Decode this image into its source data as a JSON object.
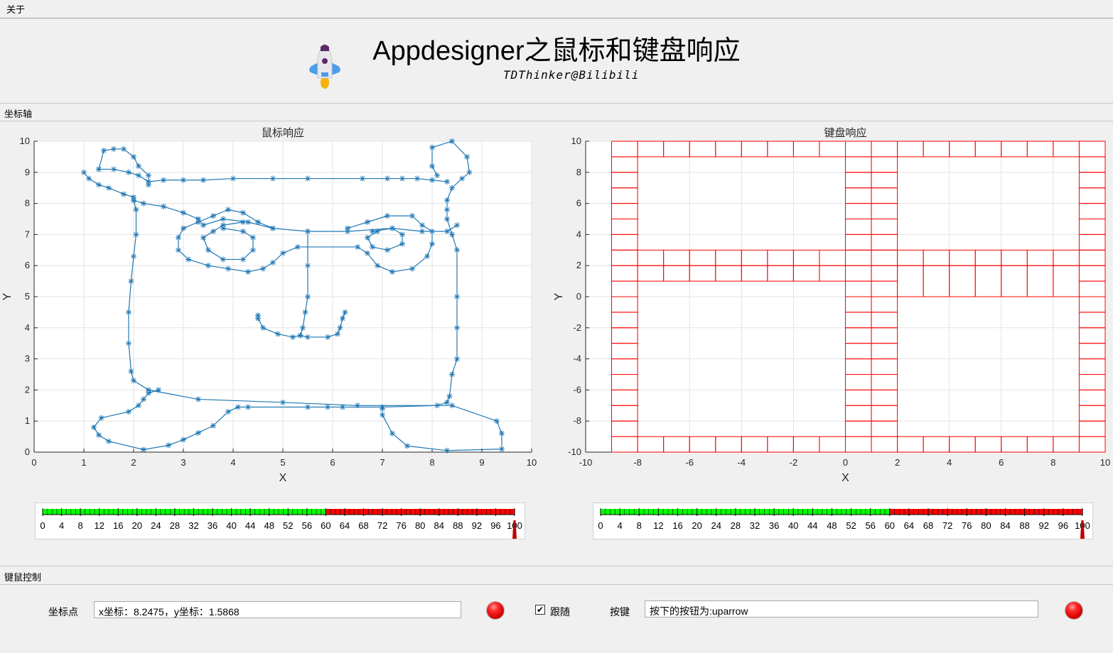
{
  "menu": {
    "about": "关于"
  },
  "header": {
    "title": "Appdesigner之鼠标和键盘响应",
    "subtitle": "TDThinker@Bilibili",
    "logo_icon": "rocket-icon"
  },
  "axes_panel": {
    "title": "坐标轴"
  },
  "control_panel": {
    "title": "键鼠控制"
  },
  "mouse_axes": {
    "title": "鼠标响应",
    "xlabel": "X",
    "ylabel": "Y",
    "xlim": [
      0,
      10
    ],
    "ylim": [
      0,
      10
    ],
    "xticks": [
      "0",
      "1",
      "2",
      "3",
      "4",
      "5",
      "6",
      "7",
      "8",
      "9",
      "10"
    ],
    "yticks": [
      "0",
      "1",
      "2",
      "3",
      "4",
      "5",
      "6",
      "7",
      "8",
      "9",
      "10"
    ],
    "line_color": "#1f77b4"
  },
  "keyboard_axes": {
    "title": "键盘响应",
    "xlabel": "X",
    "ylabel": "Y",
    "xlim": [
      -10,
      10
    ],
    "ylim": [
      -10,
      10
    ],
    "xticks": [
      "-10",
      "-8",
      "-6",
      "-4",
      "-2",
      "0",
      "2",
      "4",
      "6",
      "8",
      "10"
    ],
    "yticks": [
      "-10",
      "-8",
      "-6",
      "-4",
      "-2",
      "0",
      "2",
      "4",
      "6",
      "8",
      "10"
    ],
    "line_color": "#ff0000"
  },
  "gauges": {
    "ticks": [
      "0",
      "4",
      "8",
      "12",
      "16",
      "20",
      "24",
      "28",
      "32",
      "36",
      "40",
      "44",
      "48",
      "52",
      "56",
      "60",
      "64",
      "68",
      "72",
      "76",
      "80",
      "84",
      "88",
      "92",
      "96",
      "100"
    ],
    "green_to": 60,
    "green_color": "#00ff00",
    "red_color": "#ff0000",
    "left_value": 100,
    "right_value": 100
  },
  "controls": {
    "coord_label": "坐标点",
    "coord_value": "x坐标：8.2475，y坐标：1.5868",
    "follow_label": "跟随",
    "follow_checked": true,
    "key_label": "按键",
    "key_value": "按下的按钮为:uparrow",
    "lamp_color": "#ff0000"
  },
  "chart_data": [
    {
      "type": "line",
      "title": "鼠标响应",
      "xlabel": "X",
      "ylabel": "Y",
      "xlim": [
        0,
        10
      ],
      "ylim": [
        0,
        10
      ],
      "series": [
        {
          "points": [
            [
              1.0,
              9.0
            ],
            [
              1.1,
              8.8
            ],
            [
              1.3,
              8.6
            ],
            [
              1.5,
              8.5
            ],
            [
              1.8,
              8.3
            ],
            [
              2.0,
              8.2
            ],
            [
              2.0,
              8.1
            ],
            [
              2.2,
              8.0
            ],
            [
              2.6,
              7.9
            ],
            [
              3.0,
              7.7
            ],
            [
              3.3,
              7.5
            ],
            [
              3.4,
              7.3
            ],
            [
              3.8,
              7.5
            ],
            [
              4.3,
              7.4
            ],
            [
              4.8,
              7.2
            ],
            [
              5.5,
              7.1
            ],
            [
              6.3,
              7.1
            ],
            [
              7.2,
              7.2
            ],
            [
              7.8,
              7.1
            ],
            [
              8.3,
              7.1
            ],
            [
              8.5,
              7.3
            ]
          ]
        },
        {
          "points": [
            [
              1.3,
              9.1
            ],
            [
              1.6,
              9.1
            ],
            [
              1.9,
              9.0
            ],
            [
              2.1,
              8.9
            ],
            [
              2.3,
              8.7
            ],
            [
              2.6,
              8.75
            ],
            [
              3.0,
              8.75
            ],
            [
              3.4,
              8.75
            ],
            [
              4.0,
              8.8
            ],
            [
              4.8,
              8.8
            ],
            [
              5.5,
              8.8
            ],
            [
              6.6,
              8.8
            ],
            [
              7.1,
              8.8
            ],
            [
              7.4,
              8.8
            ],
            [
              7.7,
              8.8
            ],
            [
              8.0,
              8.75
            ],
            [
              8.3,
              8.7
            ]
          ]
        },
        {
          "points": [
            [
              1.3,
              9.1
            ],
            [
              1.4,
              9.7
            ],
            [
              1.6,
              9.75
            ],
            [
              1.8,
              9.75
            ],
            [
              2.0,
              9.5
            ],
            [
              2.1,
              9.2
            ],
            [
              2.3,
              8.9
            ],
            [
              2.3,
              8.6
            ]
          ]
        },
        {
          "points": [
            [
              8.1,
              8.9
            ],
            [
              8.0,
              9.2
            ],
            [
              8.0,
              9.8
            ],
            [
              8.4,
              10.0
            ],
            [
              8.7,
              9.5
            ],
            [
              8.75,
              9.0
            ],
            [
              8.6,
              8.8
            ],
            [
              8.4,
              8.5
            ],
            [
              8.3,
              8.1
            ],
            [
              8.3,
              7.8
            ],
            [
              8.3,
              7.5
            ],
            [
              8.4,
              7.0
            ],
            [
              8.5,
              6.5
            ],
            [
              8.5,
              5.0
            ],
            [
              8.5,
              4.0
            ],
            [
              8.5,
              3.0
            ],
            [
              8.4,
              2.5
            ],
            [
              8.35,
              1.8
            ],
            [
              8.3,
              1.6
            ],
            [
              8.1,
              1.5
            ],
            [
              7.0,
              1.45
            ],
            [
              6.2,
              1.45
            ],
            [
              5.9,
              1.45
            ],
            [
              5.5,
              1.45
            ],
            [
              4.3,
              1.45
            ],
            [
              4.1,
              1.45
            ],
            [
              3.9,
              1.3
            ],
            [
              3.6,
              0.85
            ],
            [
              3.3,
              0.62
            ],
            [
              3.0,
              0.4
            ],
            [
              2.7,
              0.22
            ],
            [
              2.2,
              0.08
            ],
            [
              1.5,
              0.35
            ],
            [
              1.3,
              0.55
            ],
            [
              1.2,
              0.8
            ],
            [
              1.35,
              1.1
            ],
            [
              1.9,
              1.3
            ],
            [
              2.1,
              1.5
            ],
            [
              2.2,
              1.7
            ],
            [
              2.3,
              1.9
            ],
            [
              2.5,
              2.0
            ]
          ]
        },
        {
          "points": [
            [
              2.0,
              8.1
            ],
            [
              2.05,
              7.8
            ],
            [
              2.05,
              7.0
            ],
            [
              2.0,
              6.3
            ],
            [
              1.95,
              5.5
            ],
            [
              1.9,
              4.5
            ],
            [
              1.9,
              3.5
            ],
            [
              1.95,
              2.6
            ],
            [
              2.0,
              2.3
            ],
            [
              2.3,
              2.0
            ],
            [
              3.3,
              1.7
            ],
            [
              5.0,
              1.6
            ],
            [
              6.5,
              1.5
            ],
            [
              8.4,
              1.5
            ],
            [
              9.3,
              1.0
            ],
            [
              9.4,
              0.6
            ],
            [
              9.4,
              0.1
            ],
            [
              8.3,
              0.05
            ],
            [
              7.5,
              0.2
            ],
            [
              7.2,
              0.6
            ],
            [
              7.0,
              1.2
            ],
            [
              7.0,
              1.4
            ]
          ]
        },
        {
          "points": [
            [
              4.8,
              7.2
            ],
            [
              4.5,
              7.4
            ],
            [
              4.2,
              7.7
            ],
            [
              3.9,
              7.8
            ],
            [
              3.6,
              7.6
            ],
            [
              3.3,
              7.4
            ],
            [
              3.0,
              7.2
            ],
            [
              2.9,
              6.9
            ],
            [
              2.9,
              6.5
            ],
            [
              3.1,
              6.2
            ],
            [
              3.5,
              6.0
            ],
            [
              3.9,
              5.9
            ],
            [
              4.3,
              5.8
            ],
            [
              4.6,
              5.9
            ],
            [
              4.8,
              6.1
            ],
            [
              5.0,
              6.4
            ],
            [
              5.3,
              6.6
            ],
            [
              6.5,
              6.6
            ],
            [
              6.7,
              6.4
            ],
            [
              6.9,
              6.0
            ],
            [
              7.2,
              5.8
            ],
            [
              7.6,
              5.9
            ],
            [
              7.9,
              6.3
            ],
            [
              8.0,
              6.7
            ],
            [
              8.0,
              7.1
            ],
            [
              7.8,
              7.3
            ],
            [
              7.6,
              7.6
            ],
            [
              7.1,
              7.6
            ],
            [
              6.7,
              7.4
            ],
            [
              6.3,
              7.2
            ]
          ]
        },
        {
          "points": [
            [
              4.2,
              7.4
            ],
            [
              3.8,
              7.3
            ],
            [
              3.6,
              7.1
            ],
            [
              3.4,
              6.9
            ],
            [
              3.5,
              6.5
            ],
            [
              3.8,
              6.2
            ],
            [
              4.2,
              6.2
            ],
            [
              4.4,
              6.5
            ],
            [
              4.4,
              6.9
            ],
            [
              4.2,
              7.1
            ],
            [
              3.8,
              7.2
            ]
          ]
        },
        {
          "points": [
            [
              6.8,
              7.1
            ],
            [
              7.2,
              7.2
            ],
            [
              7.4,
              7.0
            ],
            [
              7.4,
              6.7
            ],
            [
              7.1,
              6.5
            ],
            [
              6.8,
              6.6
            ],
            [
              6.7,
              6.9
            ],
            [
              6.9,
              7.1
            ]
          ]
        },
        {
          "points": [
            [
              5.5,
              7.1
            ],
            [
              5.5,
              6.0
            ],
            [
              5.5,
              5.0
            ],
            [
              5.45,
              4.5
            ],
            [
              5.4,
              4.0
            ],
            [
              5.35,
              3.75
            ],
            [
              5.2,
              3.7
            ],
            [
              4.9,
              3.8
            ],
            [
              4.6,
              4.0
            ],
            [
              4.5,
              4.3
            ],
            [
              4.5,
              4.4
            ]
          ]
        },
        {
          "points": [
            [
              5.35,
              3.75
            ],
            [
              5.5,
              3.7
            ],
            [
              5.9,
              3.7
            ],
            [
              6.1,
              3.8
            ],
            [
              6.15,
              4.0
            ],
            [
              6.2,
              4.3
            ],
            [
              6.25,
              4.5
            ]
          ]
        }
      ]
    },
    {
      "type": "line",
      "title": "键盘响应",
      "xlabel": "X",
      "ylabel": "Y",
      "xlim": [
        -10,
        10
      ],
      "ylim": [
        -10,
        10
      ],
      "description_series": "red grid of rectangles (cells 1 wide x 1 tall in x, ~1 unit in y) outlining two letter shapes",
      "outline": [
        [
          -9,
          10
        ],
        [
          10,
          10
        ],
        [
          10,
          -10
        ],
        [
          -9,
          -10
        ],
        [
          -9,
          10
        ]
      ]
    }
  ]
}
